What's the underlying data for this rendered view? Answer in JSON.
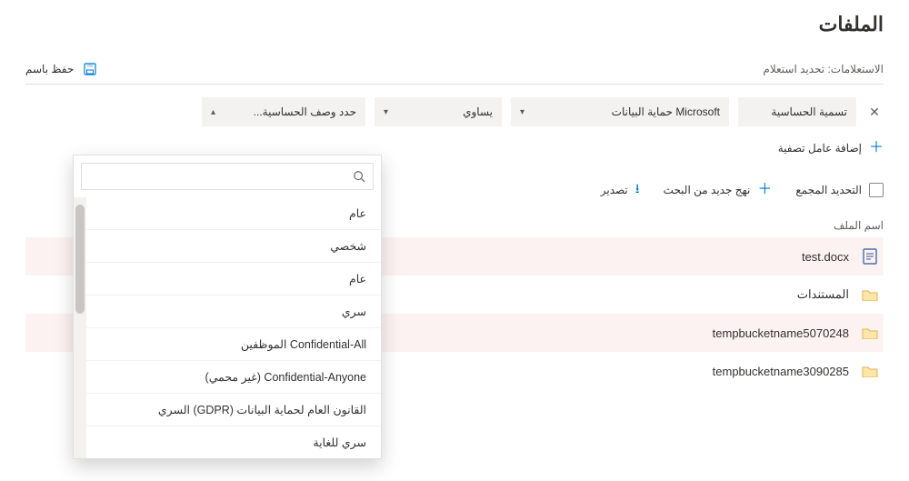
{
  "title": "الملفات",
  "queries": {
    "label": "الاستعلامات: تحديد استعلام",
    "save_as": "حفظ باسم"
  },
  "filter": {
    "field": "تسمية الحساسية",
    "source": "Microsoft حماية البيانات",
    "operator": "يساوي",
    "value_placeholder": "حدد وصف الحساسية..."
  },
  "add_filter_label": "إضافة عامل تصفية",
  "toolbar": {
    "select_all": "التحديد المجمع",
    "new_policy": "نهج جديد من البحث",
    "export": "تصدير"
  },
  "column_header": "اسم الملف",
  "rows": [
    {
      "kind": "doc",
      "name": "test.docx"
    },
    {
      "kind": "folder",
      "name": "المستندات"
    },
    {
      "kind": "folder",
      "name": "tempbucketname5070248"
    },
    {
      "kind": "folder",
      "name": "tempbucketname3090285"
    }
  ],
  "dropdown": {
    "search_placeholder": "",
    "items": [
      "عام",
      "شخصي",
      "عام",
      "سري",
      "Confidential-All الموظفين",
      "Confidential-Anyone (غير محمي)",
      "القانون العام لحماية البيانات (GDPR) السري",
      "سري للغاية"
    ]
  }
}
